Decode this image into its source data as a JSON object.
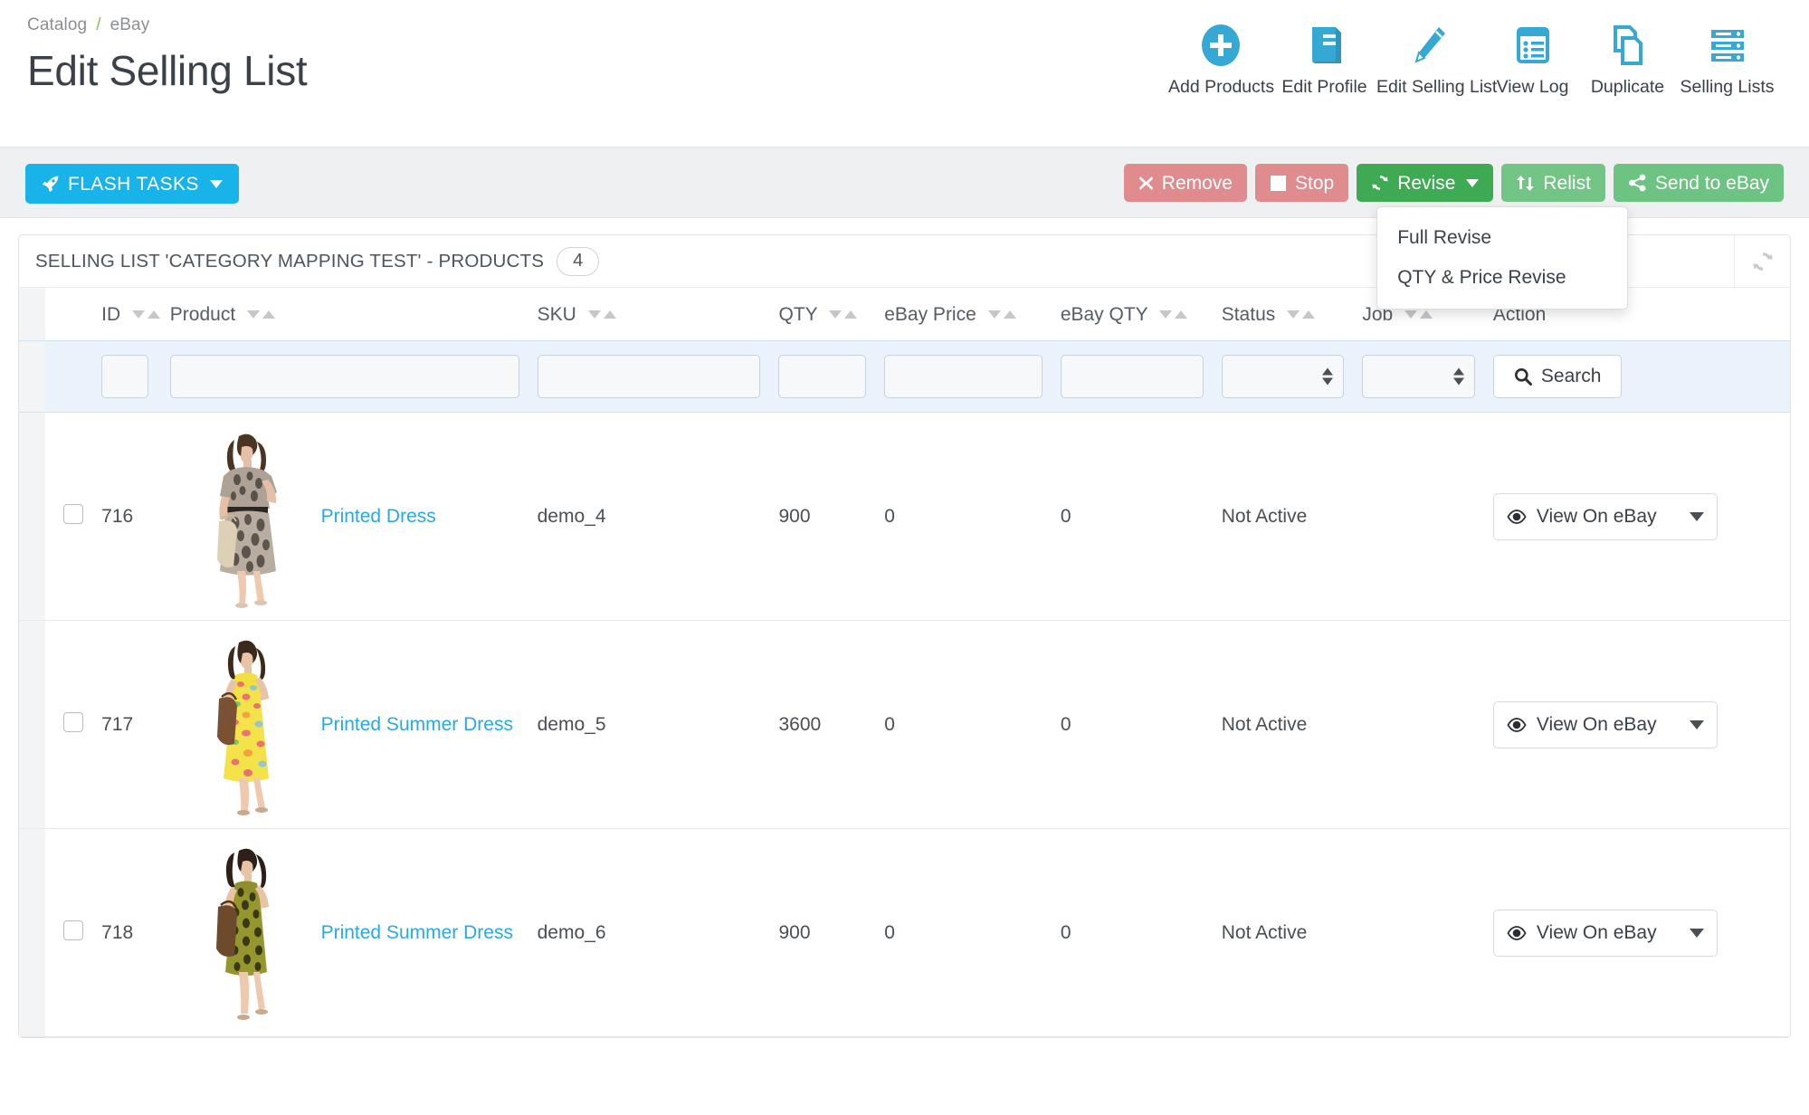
{
  "breadcrumb": {
    "items": [
      "Catalog",
      "eBay"
    ],
    "separator": "/"
  },
  "page_title": "Edit Selling List",
  "header_actions": [
    {
      "label": "Add Products",
      "icon": "plus-circle-icon"
    },
    {
      "label": "Edit Profile",
      "icon": "book-icon"
    },
    {
      "label": "Edit Selling List",
      "icon": "pencil-icon"
    },
    {
      "label": "View Log",
      "icon": "list-icon"
    },
    {
      "label": "Duplicate",
      "icon": "copy-icon"
    },
    {
      "label": "Selling Lists",
      "icon": "server-icon"
    }
  ],
  "toolbar": {
    "flash_tasks_label": "FLASH TASKS",
    "remove_label": "Remove",
    "stop_label": "Stop",
    "revise_label": "Revise",
    "relist_label": "Relist",
    "send_label": "Send to eBay",
    "revise_menu": [
      {
        "label": "Full Revise"
      },
      {
        "label": "QTY & Price Revise"
      }
    ]
  },
  "panel": {
    "title": "SELLING LIST 'CATEGORY MAPPING TEST' - PRODUCTS",
    "count": "4",
    "refresh_icon": "refresh-icon"
  },
  "table": {
    "columns": [
      {
        "key": "id",
        "label": "ID",
        "sortable": true
      },
      {
        "key": "product",
        "label": "Product",
        "sortable": true
      },
      {
        "key": "sku",
        "label": "SKU",
        "sortable": true
      },
      {
        "key": "qty",
        "label": "QTY",
        "sortable": true
      },
      {
        "key": "ebay_price",
        "label": "eBay Price",
        "sortable": true
      },
      {
        "key": "ebay_qty",
        "label": "eBay QTY",
        "sortable": true
      },
      {
        "key": "status",
        "label": "Status",
        "sortable": true
      },
      {
        "key": "job",
        "label": "Job",
        "sortable": true
      },
      {
        "key": "action",
        "label": "Action",
        "sortable": false
      }
    ],
    "filters": {
      "id": "",
      "product": "",
      "sku": "",
      "qty": "",
      "ebay_price": "",
      "ebay_qty": "",
      "status": "",
      "job": "",
      "search_label": "Search"
    },
    "rows": [
      {
        "checked": false,
        "id": "716",
        "product": "Printed Dress",
        "sku": "demo_4",
        "qty": "900",
        "ebay_price": "0",
        "ebay_qty": "0",
        "status": "Not Active",
        "job": "",
        "action_label": "View On eBay",
        "thumb": "dress-printed-grey"
      },
      {
        "checked": false,
        "id": "717",
        "product": "Printed Summer Dress",
        "sku": "demo_5",
        "qty": "3600",
        "ebay_price": "0",
        "ebay_qty": "0",
        "status": "Not Active",
        "job": "",
        "action_label": "View On eBay",
        "thumb": "dress-summer-yellow"
      },
      {
        "checked": false,
        "id": "718",
        "product": "Printed Summer Dress",
        "sku": "demo_6",
        "qty": "900",
        "ebay_price": "0",
        "ebay_qty": "0",
        "status": "Not Active",
        "job": "",
        "action_label": "View On eBay",
        "thumb": "dress-summer-olive"
      }
    ]
  },
  "colors": {
    "brand_blue": "#29a9e1",
    "flash_blue": "#18b3e8",
    "danger": "#e08b8e",
    "success_dark": "#3faa54",
    "success": "#6cc382",
    "link": "#29a9e1",
    "breadcrumb_sep": "#7ec64a"
  }
}
